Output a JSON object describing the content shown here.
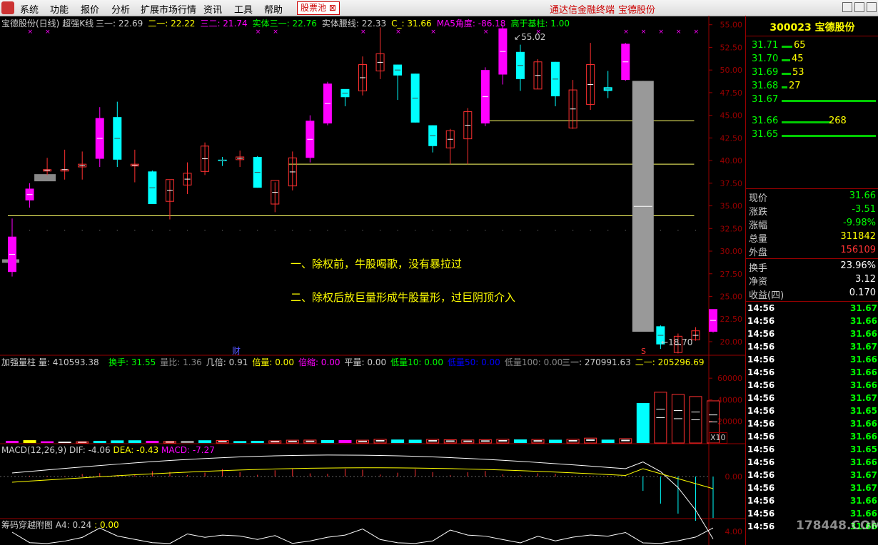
{
  "menu": {
    "items": [
      "系统",
      "功能",
      "报价",
      "分析",
      "扩展市场行情",
      "资讯",
      "工具",
      "帮助"
    ],
    "tag": "股票池",
    "right1": "通达信金融终端",
    "right2": "宝德股份"
  },
  "main": {
    "title": "宝德股份(日线)",
    "indicator": "超强K线",
    "items": [
      {
        "t": "三一: 22.69",
        "c": "#ccc"
      },
      {
        "t": "二一: 22.22",
        "c": "#ff0"
      },
      {
        "t": "三二: 21.74",
        "c": "#f0f"
      },
      {
        "t": "实体三一: 22.76",
        "c": "#0f0"
      },
      {
        "t": "实体腰线: 22.33",
        "c": "#ccc"
      },
      {
        "t": "C_: 31.66",
        "c": "#ff0"
      },
      {
        "t": "MA5角度: -86.18",
        "c": "#f0f"
      },
      {
        "t": "高于基柱: 1.00",
        "c": "#0f0"
      }
    ],
    "peak_label": "55.02",
    "low_label": "18.70",
    "cai": "财",
    "s_mark": "S",
    "note1": "一、除权前，牛股喝歌，没有暴拉过",
    "note2": "二、除权后放巨量形成牛股量形，过巨阴顶介入",
    "yticks": [
      "55.00",
      "52.50",
      "50.00",
      "47.50",
      "45.00",
      "42.50",
      "40.00",
      "37.50",
      "35.00",
      "32.50",
      "30.00",
      "27.50",
      "25.00",
      "22.50",
      "20.00"
    ]
  },
  "vol": {
    "name": "加强量柱",
    "vol": "量: 410593.38",
    "items": [
      {
        "t": "换手: 31.55",
        "c": "#0f0"
      },
      {
        "t": "量比: 1.36",
        "c": "#888"
      },
      {
        "t": "几倍: 0.91",
        "c": "#ccc"
      },
      {
        "t": "倍量: 0.00",
        "c": "#ff0"
      },
      {
        "t": "倍缩: 0.00",
        "c": "#f0f"
      },
      {
        "t": "平量: 0.00",
        "c": "#ccc"
      },
      {
        "t": "低量10: 0.00",
        "c": "#0f0"
      },
      {
        "t": "低量50: 0.00",
        "c": "#00f"
      },
      {
        "t": "低量100: 0.00",
        "c": "#888"
      }
    ],
    "right_items": [
      {
        "t": "三一: 270991.63",
        "c": "#ccc"
      },
      {
        "t": "二一: 205296.69",
        "c": "#ff0"
      }
    ],
    "yticks": [
      "60000",
      "40000",
      "20000"
    ],
    "x10": "X10"
  },
  "macd": {
    "label": "MACD(12,26,9)",
    "dif": "DIF: -4.06",
    "dea": "DEA: -0.43",
    "macd": "MACD: -7.27",
    "ytick": "0.00"
  },
  "chip": {
    "label": "筹码穿越附图",
    "a4": "A4: 0.24",
    "v": ": 0.00",
    "ytick": "4.00"
  },
  "right": {
    "code": "300023 宝德股份",
    "ask": [
      {
        "p": "31.71",
        "v": "65",
        "w": 15
      },
      {
        "p": "31.70",
        "v": "45",
        "w": 12
      },
      {
        "p": "31.69",
        "v": "53",
        "w": 13
      },
      {
        "p": "31.68",
        "v": "27",
        "w": 8
      },
      {
        "p": "31.67",
        "v": "",
        "w": 132
      }
    ],
    "bid": [
      {
        "p": "31.66",
        "v": "268",
        "w": 70
      },
      {
        "p": "31.65",
        "v": "",
        "w": 132
      }
    ],
    "stats": [
      {
        "k": "现价",
        "v": "31.66",
        "c": "#0f0"
      },
      {
        "k": "涨跌",
        "v": "-3.51",
        "c": "#0f0"
      },
      {
        "k": "涨幅",
        "v": "-9.98%",
        "c": "#0f0"
      },
      {
        "k": "总量",
        "v": "311842",
        "c": "#ff0"
      },
      {
        "k": "外盘",
        "v": "156109",
        "c": "#f33"
      }
    ],
    "stats2": [
      {
        "k": "换手",
        "v": "23.96%",
        "c": "#fff"
      },
      {
        "k": "净资",
        "v": "3.12",
        "c": "#fff"
      },
      {
        "k": "收益(四)",
        "v": "0.170",
        "c": "#fff"
      }
    ],
    "ticks": [
      {
        "t": "14:56",
        "p": "31.67"
      },
      {
        "t": "14:56",
        "p": "31.66"
      },
      {
        "t": "14:56",
        "p": "31.66"
      },
      {
        "t": "14:56",
        "p": "31.67"
      },
      {
        "t": "14:56",
        "p": "31.66"
      },
      {
        "t": "14:56",
        "p": "31.66"
      },
      {
        "t": "14:56",
        "p": "31.66"
      },
      {
        "t": "14:56",
        "p": "31.67"
      },
      {
        "t": "14:56",
        "p": "31.65"
      },
      {
        "t": "14:56",
        "p": "31.66"
      },
      {
        "t": "14:56",
        "p": "31.66"
      },
      {
        "t": "14:56",
        "p": "31.65"
      },
      {
        "t": "14:56",
        "p": "31.66"
      },
      {
        "t": "14:56",
        "p": "31.67"
      },
      {
        "t": "14:56",
        "p": "31.67"
      },
      {
        "t": "14:56",
        "p": "31.66"
      },
      {
        "t": "14:56",
        "p": "31.66"
      },
      {
        "t": "14:56",
        "p": "31.66"
      }
    ],
    "watermark": "178448.COM"
  },
  "chart_data": {
    "type": "candlestick",
    "ylim": [
      18.5,
      56
    ],
    "candles": [
      {
        "o": 27.7,
        "h": 33.6,
        "l": 27.2,
        "c": 31.6,
        "col": "m"
      },
      {
        "o": 35.6,
        "h": 37.5,
        "l": 34.8,
        "c": 36.9,
        "col": "m"
      },
      {
        "o": 38.9,
        "h": 40.3,
        "l": 38.4,
        "c": 39.0,
        "col": "r"
      },
      {
        "o": 39.0,
        "h": 41.2,
        "l": 37.9,
        "c": 39.0,
        "col": "r"
      },
      {
        "o": 39.3,
        "h": 41.0,
        "l": 37.9,
        "c": 39.6,
        "col": "r"
      },
      {
        "o": 40.2,
        "h": 45.9,
        "l": 39.3,
        "c": 44.7,
        "col": "m"
      },
      {
        "o": 44.8,
        "h": 46.5,
        "l": 39.3,
        "c": 40.1,
        "col": "c"
      },
      {
        "o": 39.6,
        "h": 41.2,
        "l": 37.6,
        "c": 39.4,
        "col": "r"
      },
      {
        "o": 38.8,
        "h": 38.9,
        "l": 35.2,
        "c": 35.2,
        "col": "c"
      },
      {
        "o": 35.5,
        "h": 37.8,
        "l": 33.5,
        "c": 37.9,
        "col": "r"
      },
      {
        "o": 37.3,
        "h": 39.8,
        "l": 36.3,
        "c": 38.6,
        "col": "r"
      },
      {
        "o": 38.8,
        "h": 42.0,
        "l": 38.4,
        "c": 41.6,
        "col": "r"
      },
      {
        "o": 40.1,
        "h": 40.4,
        "l": 39.4,
        "c": 40.0,
        "col": "c"
      },
      {
        "o": 40.1,
        "h": 41.1,
        "l": 39.3,
        "c": 40.4,
        "col": "r"
      },
      {
        "o": 40.4,
        "h": 40.5,
        "l": 37.0,
        "c": 37.0,
        "col": "c"
      },
      {
        "o": 35.2,
        "h": 37.6,
        "l": 34.3,
        "c": 37.8,
        "col": "r"
      },
      {
        "o": 37.2,
        "h": 41.0,
        "l": 36.7,
        "c": 40.3,
        "col": "r"
      },
      {
        "o": 40.3,
        "h": 45.0,
        "l": 39.8,
        "c": 44.4,
        "col": "m"
      },
      {
        "o": 44.1,
        "h": 48.7,
        "l": 43.9,
        "c": 48.5,
        "col": "m"
      },
      {
        "o": 47.0,
        "h": 47.8,
        "l": 46.0,
        "c": 47.9,
        "col": "c"
      },
      {
        "o": 47.7,
        "h": 51.5,
        "l": 47.2,
        "c": 50.6,
        "col": "r"
      },
      {
        "o": 49.9,
        "h": 54.7,
        "l": 49.0,
        "c": 51.8,
        "col": "r"
      },
      {
        "o": 50.6,
        "h": 50.6,
        "l": 46.7,
        "c": 49.4,
        "col": "c"
      },
      {
        "o": 49.6,
        "h": 49.6,
        "l": 44.2,
        "c": 44.2,
        "col": "c"
      },
      {
        "o": 43.9,
        "h": 43.9,
        "l": 40.9,
        "c": 41.6,
        "col": "c"
      },
      {
        "o": 41.4,
        "h": 43.5,
        "l": 39.6,
        "c": 43.3,
        "col": "r"
      },
      {
        "o": 42.4,
        "h": 45.8,
        "l": 39.6,
        "c": 45.4,
        "col": "r"
      },
      {
        "o": 44.1,
        "h": 50.3,
        "l": 43.8,
        "c": 50.0,
        "col": "m"
      },
      {
        "o": 49.5,
        "h": 55.0,
        "l": 48.4,
        "c": 54.6,
        "col": "m"
      },
      {
        "o": 52.0,
        "h": 52.8,
        "l": 47.7,
        "c": 49.0,
        "col": "c"
      },
      {
        "o": 47.9,
        "h": 51.2,
        "l": 47.9,
        "c": 50.9,
        "col": "r"
      },
      {
        "o": 50.9,
        "h": 50.9,
        "l": 46.0,
        "c": 47.1,
        "col": "c"
      },
      {
        "o": 43.6,
        "h": 48.9,
        "l": 43.5,
        "c": 47.8,
        "col": "r"
      },
      {
        "o": 46.2,
        "h": 53.0,
        "l": 45.6,
        "c": 50.6,
        "col": "r"
      },
      {
        "o": 47.7,
        "h": 49.9,
        "l": 46.9,
        "c": 48.1,
        "col": "c"
      },
      {
        "o": 48.9,
        "h": 53.0,
        "l": 48.8,
        "c": 52.9,
        "col": "m"
      },
      {
        "o": 48.8,
        "h": 48.8,
        "l": 21.1,
        "c": 21.1,
        "col": "g"
      },
      {
        "o": 21.7,
        "h": 21.8,
        "l": 19.2,
        "c": 19.7,
        "col": "c"
      },
      {
        "o": 18.8,
        "h": 20.9,
        "l": 18.7,
        "c": 20.6,
        "col": "r"
      },
      {
        "o": 20.2,
        "h": 21.6,
        "l": 20.1,
        "c": 21.2,
        "col": "r"
      },
      {
        "o": 21.1,
        "h": 23.3,
        "l": 21.0,
        "c": 23.6,
        "col": "m"
      }
    ],
    "hlines": [
      {
        "y": 33.9,
        "x0": 0,
        "x1": 39
      },
      {
        "y": 39.6,
        "x0": 16,
        "x1": 39
      },
      {
        "y": 44.4,
        "x0": 27,
        "x1": 39
      }
    ],
    "volumes": [
      2000,
      2600,
      1600,
      1200,
      1200,
      2000,
      2400,
      2500,
      2000,
      1500,
      2000,
      2500,
      2300,
      1800,
      2000,
      2000,
      2600,
      2700,
      2700,
      2700,
      2600,
      3500,
      3200,
      3000,
      3400,
      3000,
      2800,
      3100,
      3500,
      3300,
      3300,
      3000,
      3500,
      4500,
      3100,
      4000,
      37000,
      47000,
      45000,
      43000,
      39000
    ],
    "vol_colors": [
      "m",
      "y",
      "m",
      "w",
      "r",
      "c",
      "c",
      "c",
      "m",
      "r",
      "g",
      "c",
      "r",
      "c",
      "c",
      "r",
      "r",
      "r",
      "c",
      "m",
      "r",
      "r",
      "c",
      "c",
      "r",
      "r",
      "r",
      "r",
      "r",
      "c",
      "r",
      "c",
      "r",
      "r",
      "c",
      "r",
      "c",
      "r",
      "r",
      "r",
      "r"
    ]
  }
}
